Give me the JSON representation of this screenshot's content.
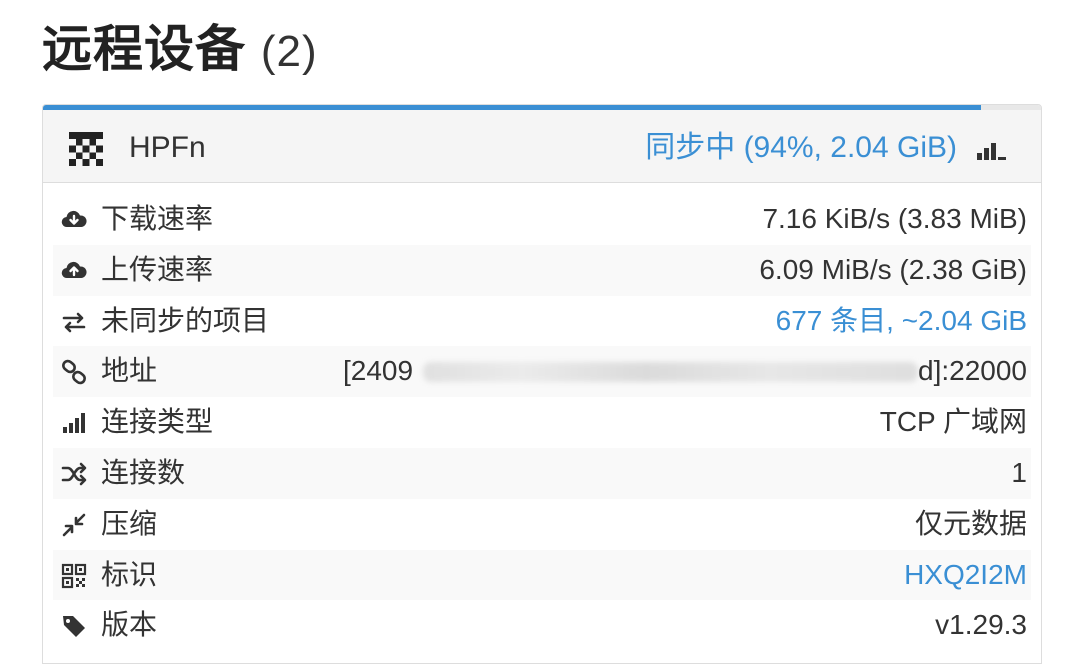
{
  "page": {
    "title": "远程设备",
    "count": "(2)"
  },
  "device": {
    "name": "HPFn",
    "status": "同步中 (94%, 2.04 GiB)",
    "progress_percent": 94,
    "identicon_icon": "device-identicon",
    "connection_icon": "signal-bars-icon"
  },
  "rows": [
    {
      "icon": "cloud-download-icon",
      "label": "下载速率",
      "value": "7.16 KiB/s (3.83 MiB)"
    },
    {
      "icon": "cloud-upload-icon",
      "label": "上传速率",
      "value": "6.09 MiB/s (2.38 GiB)"
    },
    {
      "icon": "exchange-arrows-icon",
      "label": "未同步的项目",
      "value": "677 条目, ~2.04 GiB"
    },
    {
      "icon": "link-icon",
      "label": "地址",
      "value_prefix": "[2409",
      "value_suffix": "d]:22000"
    },
    {
      "icon": "signal-bars-icon",
      "label": "连接类型",
      "value": "TCP 广域网"
    },
    {
      "icon": "shuffle-icon",
      "label": "连接数",
      "value": "1"
    },
    {
      "icon": "compress-arrows-icon",
      "label": "压缩",
      "value": "仅元数据"
    },
    {
      "icon": "qrcode-icon",
      "label": "标识",
      "value": "HXQ2I2M"
    },
    {
      "icon": "tag-icon",
      "label": "版本",
      "value": "v1.29.3"
    }
  ],
  "colors": {
    "accent": "#3a8fd4",
    "text": "#333333",
    "header_bg": "#f5f5f5",
    "stripe_bg": "#f9f9f9"
  }
}
